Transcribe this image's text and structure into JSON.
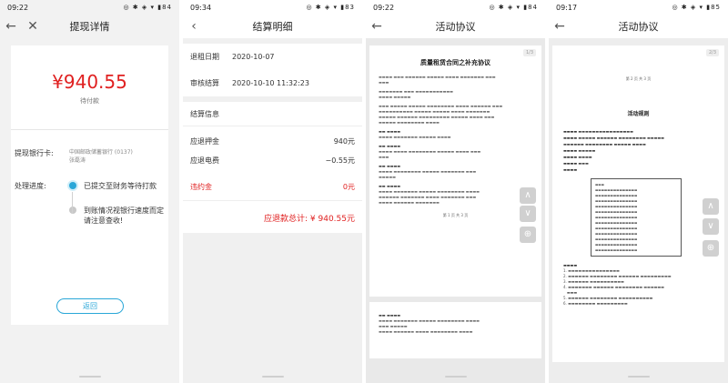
{
  "screen1": {
    "status": {
      "time": "09:22",
      "battery": "84"
    },
    "title": "提现详情",
    "amount": "¥940.55",
    "amount_status": "待付款",
    "bank_label": "提现银行卡:",
    "bank_name": "中国邮政储蓄银行 (0137)",
    "bank_holder": "张磊涛",
    "progress_label": "处理进度:",
    "step1": "已提交至财务等待打款",
    "step2a": "到账情况视银行速度而定",
    "step2b": "请注意查收!",
    "back_button": "返回"
  },
  "screen2": {
    "status": {
      "time": "09:34",
      "battery": "83"
    },
    "title": "结算明细",
    "rows": [
      {
        "label": "退租日期",
        "value": "2020-10-07"
      },
      {
        "label": "审核结算",
        "value": "2020-10-10 11:32:23"
      }
    ],
    "section_title": "结算信息",
    "lines": [
      {
        "label": "应退押金",
        "value": "940元"
      },
      {
        "label": "应退电费",
        "value": "−0.55元"
      },
      {
        "label": "违约金",
        "value": "0元"
      }
    ],
    "total": "应退款总计: ¥ 940.55元"
  },
  "screen3": {
    "status": {
      "time": "09:22",
      "battery": "84"
    },
    "title": "活动协议",
    "page_badge": "1/3",
    "doc_title": "质量租赁合同之补充协议",
    "page_number": "第 1 页 共 3 页"
  },
  "screen4": {
    "status": {
      "time": "09:17",
      "battery": "85"
    },
    "title": "活动协议",
    "page_badge": "2/3",
    "page_number": "第 2 页 共 3 页",
    "rule_title": "活动规则"
  },
  "colors": {
    "accent": "#2aa7d8",
    "red": "#e02020"
  }
}
